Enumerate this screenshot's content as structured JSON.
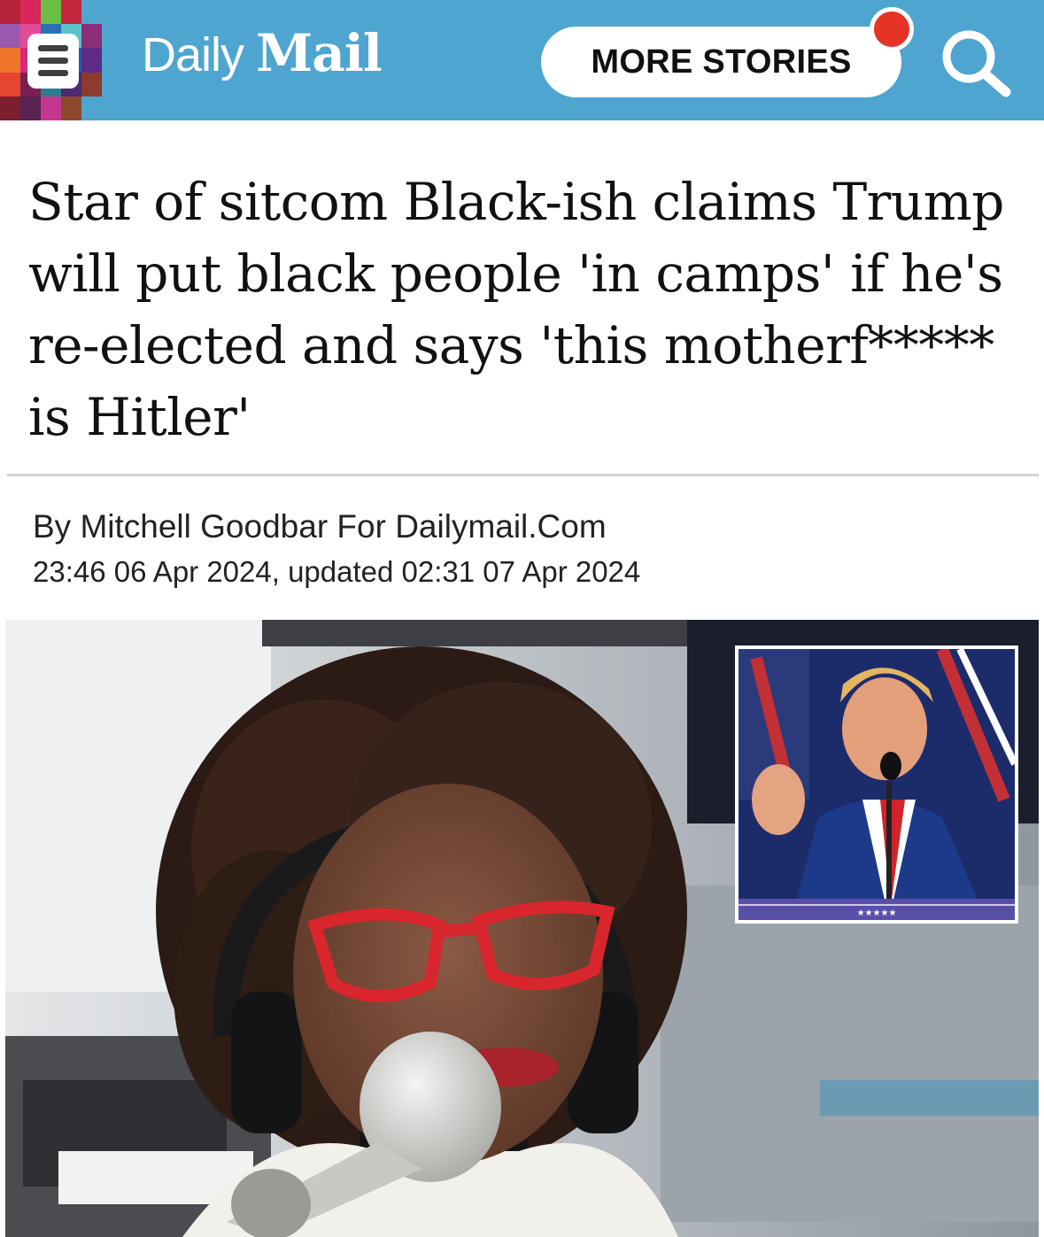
{
  "header": {
    "logo_daily": "Daily",
    "logo_mail": "Mail",
    "more_stories_label": "MORE STORIES",
    "colors": {
      "bar": "#4ea5d0",
      "notification": "#e53325"
    },
    "icons": [
      "hamburger-menu-icon",
      "notification-dot",
      "search-icon"
    ]
  },
  "article": {
    "headline": "Star of sitcom Black-ish claims Trump will put black people 'in camps' if he's re-elected and says 'this motherf***** is Hitler'",
    "byline": "By Mitchell Goodbar For Dailymail.Com",
    "dateline": "23:46 06 Apr 2024, updated 02:31 07 Apr 2024"
  },
  "media": {
    "main_image": "woman-with-red-glasses-at-microphone",
    "inset_image": "man-at-podium-microphone",
    "inset_caption_stars": "★★★★★"
  }
}
